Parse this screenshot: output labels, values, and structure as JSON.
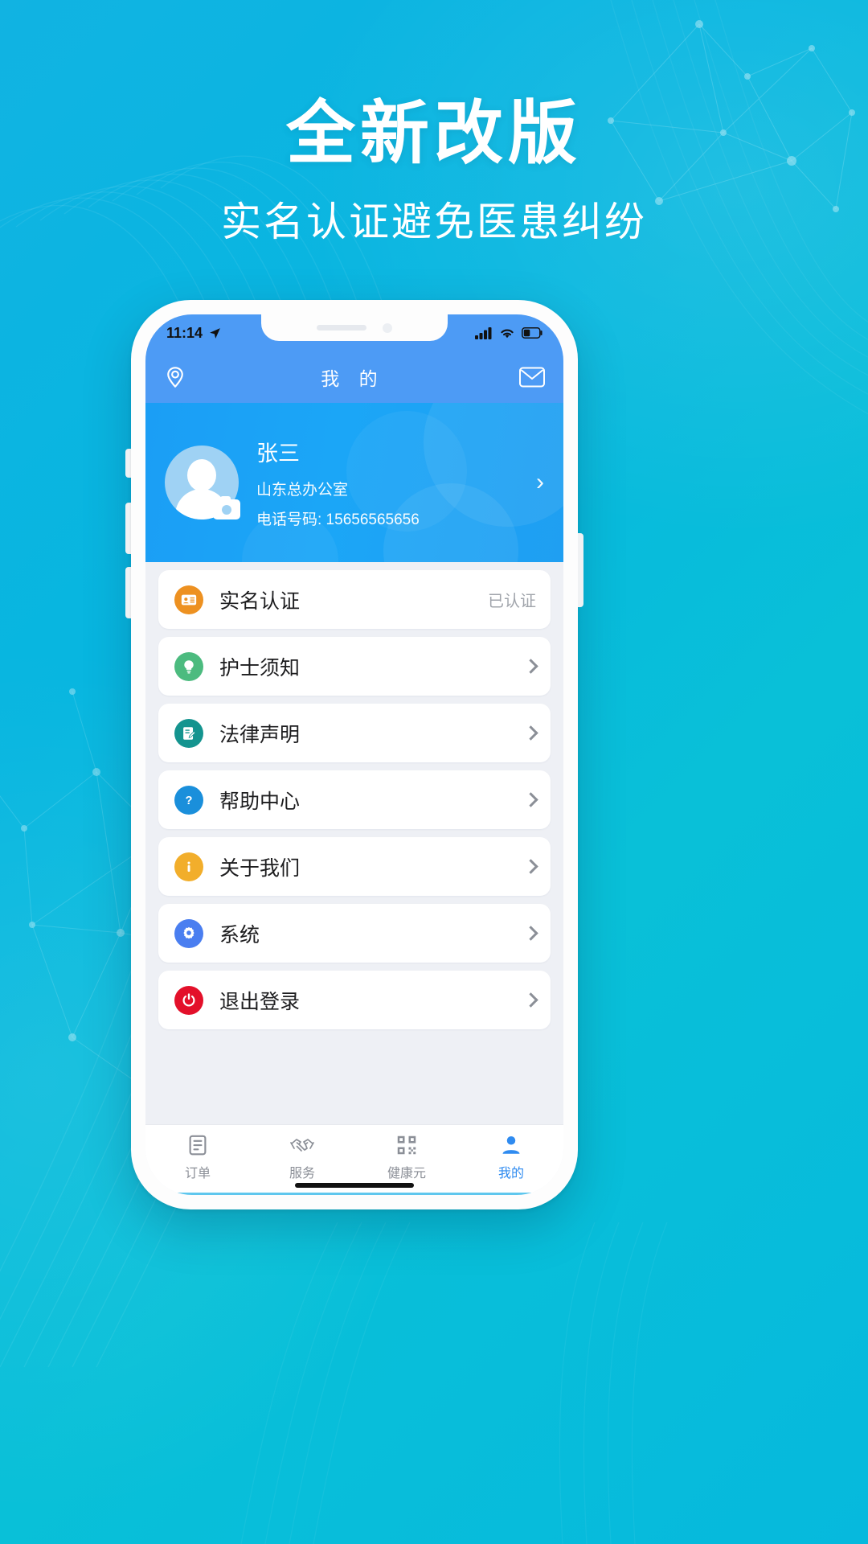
{
  "poster": {
    "headline": "全新改版",
    "subheadline": "实名认证避免医患纠纷",
    "bg_color": "#0bb6de",
    "accent_color": "#2f8bf0"
  },
  "phone": {
    "statusbar": {
      "time": "11:14",
      "location_icon": "location-arrow-icon",
      "signal_icon": "cellular-signal-icon",
      "wifi_icon": "wifi-icon",
      "battery_icon": "battery-icon"
    },
    "navbar": {
      "left_icon": "location-pin-icon",
      "title": "我 的",
      "right_icon": "envelope-icon"
    },
    "profile": {
      "avatar_icon": "user-avatar-icon",
      "camera_badge_icon": "camera-icon",
      "name": "张三",
      "department": "山东总办公室",
      "phone_label": "电话号码: 15656565656",
      "arrow": "›",
      "card_color": "#1ba3f6"
    },
    "menu": [
      {
        "label": "实名认证",
        "icon": "id-card-icon",
        "icon_color": "#ed9121",
        "status": "已认证",
        "has_chevron": false
      },
      {
        "label": "护士须知",
        "icon": "lightbulb-icon",
        "icon_color": "#4cbb7f",
        "status": "",
        "has_chevron": true
      },
      {
        "label": "法律声明",
        "icon": "document-edit-icon",
        "icon_color": "#14948f",
        "status": "",
        "has_chevron": true
      },
      {
        "label": "帮助中心",
        "icon": "question-mark-icon",
        "icon_color": "#1a8fdb",
        "status": "",
        "has_chevron": true
      },
      {
        "label": "关于我们",
        "icon": "info-icon",
        "icon_color": "#f2ae2b",
        "status": "",
        "has_chevron": true
      },
      {
        "label": "系统",
        "icon": "gear-icon",
        "icon_color": "#4a7ef0",
        "status": "",
        "has_chevron": true
      },
      {
        "label": "退出登录",
        "icon": "power-icon",
        "icon_color": "#e3102a",
        "status": "",
        "has_chevron": true
      }
    ],
    "tabs": [
      {
        "label": "订单",
        "icon": "list-order-icon",
        "active": false
      },
      {
        "label": "服务",
        "icon": "handshake-icon",
        "active": false
      },
      {
        "label": "健康元",
        "icon": "qr-code-icon",
        "active": false
      },
      {
        "label": "我的",
        "icon": "person-icon",
        "active": true
      }
    ]
  }
}
